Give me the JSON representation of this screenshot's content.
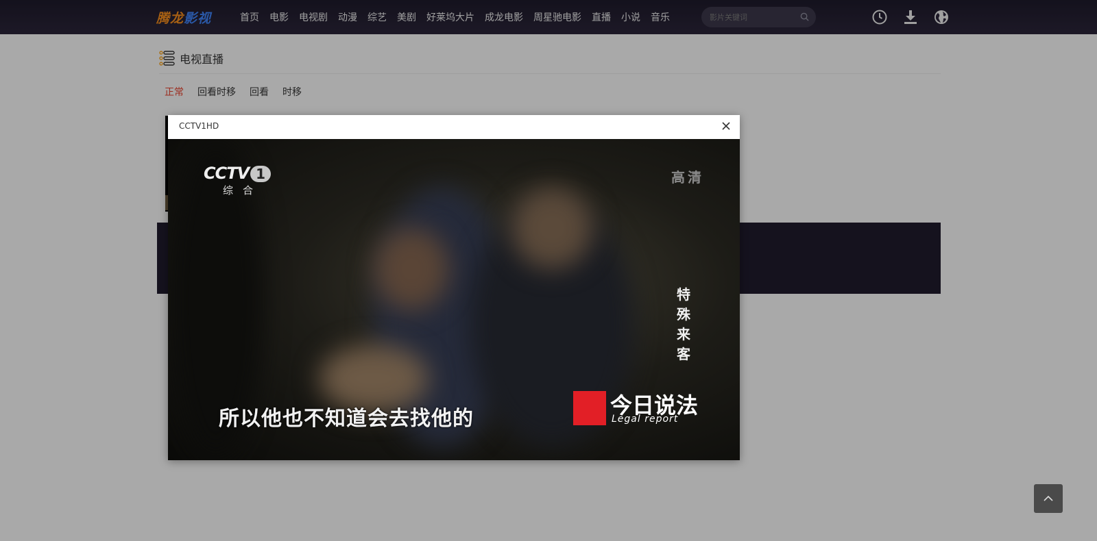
{
  "header": {
    "logo_part1": "腾龙",
    "logo_part2": "影视",
    "nav": [
      "首页",
      "电影",
      "电视剧",
      "动漫",
      "综艺",
      "美剧",
      "好莱坞大片",
      "成龙电影",
      "周星驰电影",
      "直播",
      "小说",
      "音乐"
    ],
    "search_placeholder": "影片关键词",
    "icons": [
      "history-icon",
      "download-icon",
      "globe-icon"
    ]
  },
  "section": {
    "title": "电视直播",
    "tabs": [
      "正常",
      "回看时移",
      "回看",
      "时移"
    ],
    "active_tab": "正常"
  },
  "modal": {
    "title": "CCTV1HD",
    "video": {
      "channel_logo": "CCTV",
      "channel_number": "1",
      "channel_sub": "综合",
      "hd_label": "高清",
      "program_name": "特殊来客",
      "subtitle": "所以他也不知道会去找他的",
      "show_logo_cn": "今日说法",
      "show_logo_en": "Legal report"
    }
  },
  "colors": {
    "header_bg": "#1d1a2a",
    "logo_orange": "#f08a1c",
    "logo_blue": "#3d7ff0",
    "active_tab": "#e0402c",
    "show_logo_red": "#e21f26"
  }
}
